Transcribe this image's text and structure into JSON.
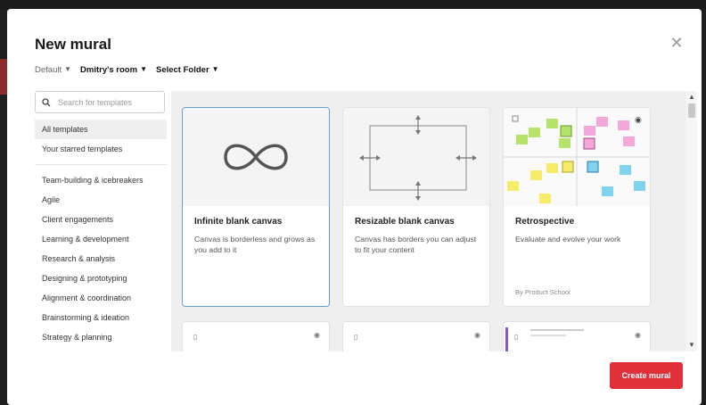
{
  "modal": {
    "title": "New mural",
    "close_icon": "close-icon"
  },
  "breadcrumbs": {
    "workspace": "Default",
    "room": "Dmitry's room",
    "folder": "Select Folder"
  },
  "search": {
    "placeholder": "Search for templates"
  },
  "sidebar": {
    "top_items": [
      {
        "label": "All templates",
        "active": true
      },
      {
        "label": "Your starred templates",
        "active": false
      }
    ],
    "categories": [
      "Team-building & icebreakers",
      "Agile",
      "Client engagements",
      "Learning & development",
      "Research & analysis",
      "Designing & prototyping",
      "Alignment & coordination",
      "Brainstorming & ideation",
      "Strategy & planning"
    ]
  },
  "templates": [
    {
      "title": "Infinite blank canvas",
      "description": "Canvas is borderless and grows as you add to it",
      "author": ""
    },
    {
      "title": "Resizable blank canvas",
      "description": "Canvas has borders you can adjust to fit your content",
      "author": ""
    },
    {
      "title": "Retrospective",
      "description": "Evaluate and evolve your work",
      "author": "By Product School"
    }
  ],
  "colors": {
    "primary_button": "#e0303a",
    "selected_border": "#6a9ce0",
    "sticky_green": "#b6e36a",
    "sticky_pink": "#f4a7d8",
    "sticky_blue": "#7fd3f0",
    "sticky_yellow": "#f7ec6a"
  },
  "actions": {
    "create_label": "Create mural"
  }
}
